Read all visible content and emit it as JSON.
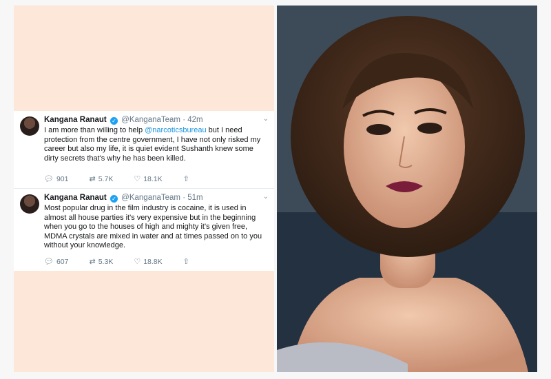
{
  "tweets": [
    {
      "name": "Kangana Ranaut",
      "handle": "@KanganaTeam",
      "time": "· 42m",
      "text_before": "I am more than willing to help ",
      "mention": "@narcoticsbureau",
      "text_after": " but I need protection from the centre government, I have not only risked my career but also my life, it is quiet evident Sushanth knew some dirty secrets that's why he has been killed.",
      "replies": "901",
      "retweets": "5.7K",
      "likes": "18.1K"
    },
    {
      "name": "Kangana Ranaut",
      "handle": "@KanganaTeam",
      "time": "· 51m",
      "text": "Most popular drug in the film industry is cocaine, it is used in almost all house parties it's very expensive but in the beginning when you go to the houses of high and mighty it's given free, MDMA crystals are mixed in water and at times passed on to you without your knowledge.",
      "replies": "607",
      "retweets": "5.3K",
      "likes": "18.8K"
    }
  ],
  "icons": {
    "reply": "reply-icon",
    "retweet": "retweet-icon",
    "like": "heart-icon",
    "share": "share-icon",
    "verified": "verified-badge-icon",
    "menu": "chevron-down-icon"
  },
  "colors": {
    "background_panel": "#fde7d8",
    "mention": "#1b95e0",
    "verified": "#1da1f2",
    "secondary_text": "#657786"
  }
}
